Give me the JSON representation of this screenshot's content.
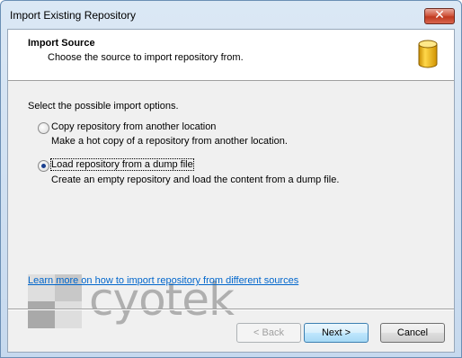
{
  "window": {
    "title": "Import Existing Repository",
    "close_glyph": "✕"
  },
  "header": {
    "title": "Import Source",
    "subtitle": "Choose the source to import repository from.",
    "icon": "database-icon"
  },
  "body": {
    "prompt": "Select the possible import options.",
    "options": [
      {
        "label": "Copy repository from another location",
        "description": "Make a hot copy of a repository from another location.",
        "selected": false
      },
      {
        "label": "Load repository from a dump file",
        "description": "Create an empty repository and load the content from a dump file.",
        "selected": true
      }
    ],
    "help_link": "Learn more on how to import repository from different sources"
  },
  "watermark": {
    "text": "cyotek"
  },
  "buttons": {
    "back": "< Back",
    "next": "Next >",
    "cancel": "Cancel"
  },
  "colors": {
    "link": "#0066cc",
    "icon_gold": "#e8b10a"
  }
}
